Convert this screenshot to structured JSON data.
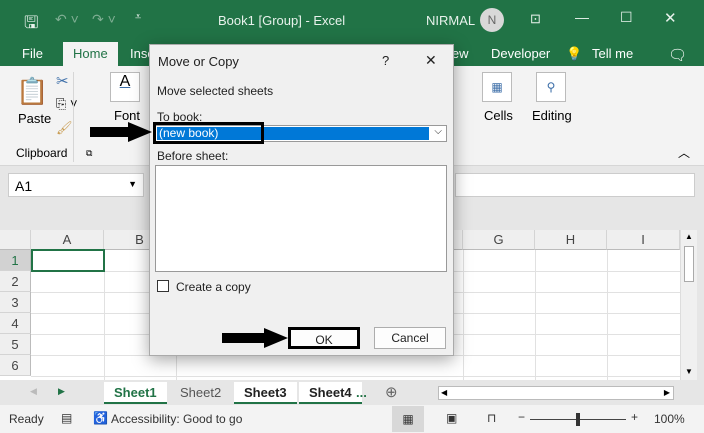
{
  "titlebar": {
    "title": "Book1  [Group]  -  Excel",
    "user": "NIRMAL",
    "avatar": "N"
  },
  "tabs": [
    "File",
    "Home",
    "Inse",
    "iew",
    "Developer",
    "Tell me"
  ],
  "ribbon": {
    "paste": "Paste",
    "clipboard": "Clipboard",
    "font": "Font",
    "cells": "Cells",
    "editing": "Editing"
  },
  "namebox": "A1",
  "columns": [
    "A",
    "B",
    "G",
    "H",
    "I"
  ],
  "rows": [
    "1",
    "2",
    "3",
    "4",
    "5",
    "6"
  ],
  "sheets": [
    "Sheet1",
    "Sheet2",
    "Sheet3",
    "Sheet4",
    "..."
  ],
  "status": {
    "ready": "Ready",
    "accessibility": "Accessibility: Good to go",
    "zoom": "100%"
  },
  "dialog": {
    "title": "Move or Copy",
    "help": "?",
    "close": "✕",
    "move_label": "Move selected sheets",
    "to_book_label": "To book:",
    "to_book_value": "(new book)",
    "before_sheet_label": "Before sheet:",
    "create_copy": "Create a copy",
    "create_copy_checked": false,
    "ok": "OK",
    "cancel": "Cancel"
  }
}
